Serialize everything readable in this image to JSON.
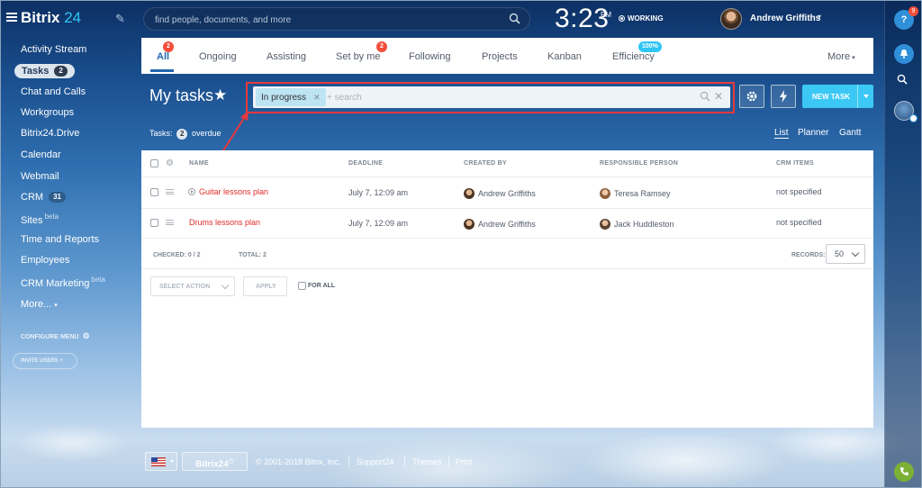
{
  "app": {
    "logo_text": "Bitrix",
    "logo_num": "24",
    "search_placeholder": "find people, documents, and more",
    "clock": "3:23",
    "ampm": "PM",
    "work_status": "WORKING",
    "user_name": "Andrew Griffiths"
  },
  "leftmenu": {
    "items": [
      {
        "label": "Activity Stream"
      },
      {
        "label": "Tasks",
        "counter": "2"
      },
      {
        "label": "Chat and Calls"
      },
      {
        "label": "Workgroups"
      },
      {
        "label": "Bitrix24.Drive"
      },
      {
        "label": "Calendar"
      },
      {
        "label": "Webmail"
      },
      {
        "label": "CRM",
        "counter": "31"
      },
      {
        "label": "Sites",
        "beta": "beta"
      },
      {
        "label": "Time and Reports"
      },
      {
        "label": "Employees"
      },
      {
        "label": "CRM Marketing",
        "beta": "beta"
      },
      {
        "label": "More..."
      }
    ],
    "configure_label": "CONFIGURE MENU",
    "invite_label": "INVITE USERS"
  },
  "rightbar": {
    "help_label": "?",
    "help_badge": "9"
  },
  "tabs": [
    {
      "label": "All",
      "badge": "2"
    },
    {
      "label": "Ongoing"
    },
    {
      "label": "Assisting"
    },
    {
      "label": "Set by me",
      "badge": "2"
    },
    {
      "label": "Following"
    },
    {
      "label": "Projects"
    },
    {
      "label": "Kanban"
    },
    {
      "label": "Efficiency",
      "badge": "100%"
    },
    {
      "label": "More"
    }
  ],
  "page": {
    "title": "My tasks",
    "star": "★",
    "filter_chip": "In progress",
    "filter_placeholder": "+ search",
    "new_task_label": "NEW TASK",
    "counter_prefix": "Tasks:",
    "counter_value": "2",
    "counter_suffix": "overdue",
    "views": [
      "List",
      "Planner",
      "Gantt"
    ]
  },
  "grid": {
    "columns": [
      "NAME",
      "DEADLINE",
      "CREATED BY",
      "RESPONSIBLE PERSON",
      "CRM ITEMS"
    ],
    "rows": [
      {
        "name": "Guitar lessons plan",
        "deadline": "July 7, 12:09 am",
        "created_by": "Andrew Griffiths",
        "responsible": "Teresa Ramsey",
        "crm": "not specified"
      },
      {
        "name": "Drums lessons plan",
        "deadline": "July 7, 12:09 am",
        "created_by": "Andrew Griffiths",
        "responsible": "Jack Huddleston",
        "crm": "not specified"
      }
    ],
    "checked_label": "CHECKED: 0 / 2",
    "total_label": "TOTAL: 2",
    "records_label": "RECORDS:",
    "records_value": "50",
    "select_action_label": "SELECT ACTION",
    "apply_label": "APPLY",
    "for_all_label": "FOR ALL"
  },
  "footer": {
    "b24_label": "Bitrix24",
    "copyright": "© 2001-2018 Bitrix, Inc.",
    "support": "Support24",
    "themes": "Themes",
    "print": "Print"
  },
  "colors": {
    "accent": "#2067b0",
    "new_task": "#3bc8f5",
    "task_link": "#e02b27",
    "badge_red": "#f44d3a",
    "highlight_red": "#e8383d"
  }
}
